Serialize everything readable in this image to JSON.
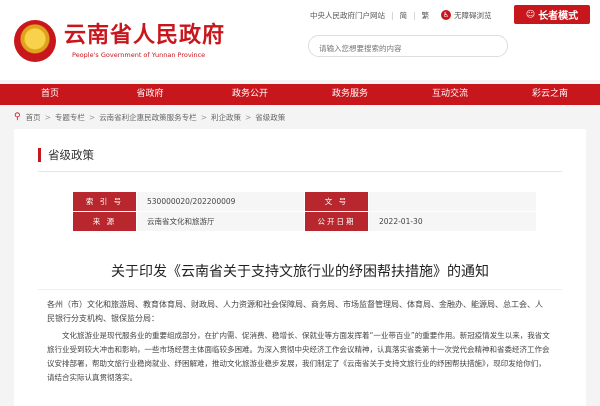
{
  "site": {
    "title": "云南省人民政府",
    "subtitle": "People's Government of Yunnan Province"
  },
  "top_links": {
    "central_gov": "中央人民政府门户网站",
    "simplified": "简",
    "traditional": "繁",
    "accessibility": "无障碍浏览",
    "elder_mode": "长者模式"
  },
  "search": {
    "placeholder": "请输入您想要搜索的内容"
  },
  "nav": [
    {
      "label": "首页"
    },
    {
      "label": "省政府"
    },
    {
      "label": "政务公开"
    },
    {
      "label": "政务服务"
    },
    {
      "label": "互动交流"
    },
    {
      "label": "彩云之南"
    }
  ],
  "breadcrumb": [
    "首页",
    "专题专栏",
    "云南省利企惠民政策服务专栏",
    "利企政策",
    "省级政策"
  ],
  "section": {
    "title": "省级政策"
  },
  "meta": {
    "index_label": "索 引 号",
    "index_value": "530000020/202200009",
    "docno_label": "文 号",
    "docno_value": "",
    "source_label": "来 源",
    "source_value": "云南省文化和旅游厅",
    "date_label": "公开日期",
    "date_value": "2022-01-30"
  },
  "document": {
    "title": "关于印发《云南省关于支持文旅行业的纾困帮扶措施》的通知",
    "address": "各州（市）文化和旅游局、教育体育局、财政局、人力资源和社会保障局、商务局、市场监督管理局、体育局、金融办、能源局、总工会、人民银行分支机构、银保监分局：",
    "paragraph": "文化旅游业是现代服务业的重要组成部分，在扩内需、促消费、稳增长、保就业等方面发挥着“一业带百业”的重要作用。新冠疫情发生以来，我省文旅行业受到较大冲击和影响，一些市场经营主体面临较多困难。为深入贯彻中央经济工作会议精神，认真落实省委第十一次党代会精神和省委经济工作会议安排部署，帮助文旅行业稳岗就业、纾困解难，推动文化旅游业稳步发展，我们制定了《云南省关于支持文旅行业的纾困帮扶措施》，现印发给你们，请结合实际认真贯彻落实。"
  },
  "colors": {
    "brand_red": "#c8161d",
    "label_red": "#b7272d"
  },
  "icons": {
    "emblem": "national-emblem-icon",
    "accessibility": "accessibility-icon",
    "elder": "elder-mode-icon",
    "breadcrumb": "location-pin-icon"
  }
}
